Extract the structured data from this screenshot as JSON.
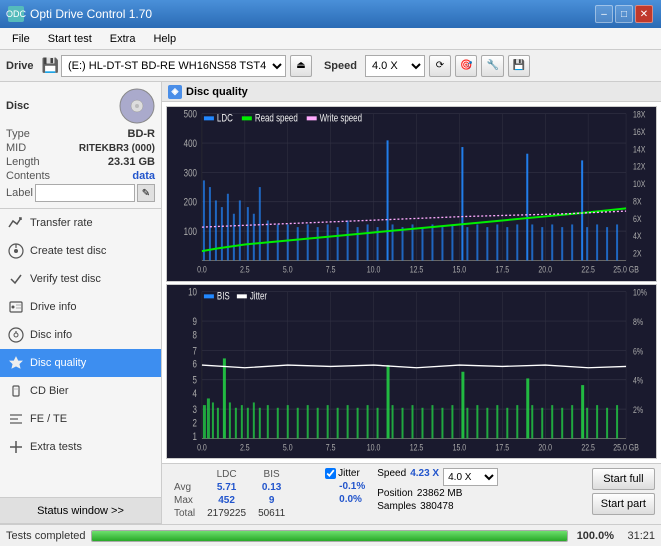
{
  "app": {
    "title": "Opti Drive Control 1.70",
    "icon": "ODC"
  },
  "titlebar": {
    "minimize": "–",
    "maximize": "□",
    "close": "✕"
  },
  "menu": {
    "items": [
      "File",
      "Start test",
      "Extra",
      "Help"
    ]
  },
  "toolbar": {
    "drive_label": "Drive",
    "drive_value": "(E:)  HL-DT-ST BD-RE  WH16NS58 TST4",
    "speed_label": "Speed",
    "speed_value": "4.0 X"
  },
  "disc": {
    "section_title": "Disc",
    "type_label": "Type",
    "type_value": "BD-R",
    "mid_label": "MID",
    "mid_value": "RITEKBR3 (000)",
    "length_label": "Length",
    "length_value": "23.31 GB",
    "contents_label": "Contents",
    "contents_value": "data",
    "label_label": "Label"
  },
  "nav": {
    "items": [
      {
        "id": "transfer-rate",
        "label": "Transfer rate",
        "icon": "📈"
      },
      {
        "id": "create-test-disc",
        "label": "Create test disc",
        "icon": "💿"
      },
      {
        "id": "verify-test-disc",
        "label": "Verify test disc",
        "icon": "✓"
      },
      {
        "id": "drive-info",
        "label": "Drive info",
        "icon": "ℹ"
      },
      {
        "id": "disc-info",
        "label": "Disc info",
        "icon": "📀"
      },
      {
        "id": "disc-quality",
        "label": "Disc quality",
        "icon": "★",
        "active": true
      },
      {
        "id": "cd-bier",
        "label": "CD Bier",
        "icon": "🍺"
      },
      {
        "id": "fe-te",
        "label": "FE / TE",
        "icon": "≋"
      },
      {
        "id": "extra-tests",
        "label": "Extra tests",
        "icon": "+"
      }
    ]
  },
  "disc_quality": {
    "title": "Disc quality"
  },
  "chart1": {
    "legend": [
      {
        "label": "LDC",
        "color": "#0099ff"
      },
      {
        "label": "Read speed",
        "color": "#00ee00"
      },
      {
        "label": "Write speed",
        "color": "#ff66ff"
      }
    ],
    "y_max": 500,
    "y_right_labels": [
      "18X",
      "16X",
      "14X",
      "12X",
      "10X",
      "8X",
      "6X",
      "4X",
      "2X"
    ],
    "x_labels": [
      "0.0",
      "2.5",
      "5.0",
      "7.5",
      "10.0",
      "12.5",
      "15.0",
      "17.5",
      "20.0",
      "22.5",
      "25.0 GB"
    ]
  },
  "chart2": {
    "legend": [
      {
        "label": "BIS",
        "color": "#0099ff"
      },
      {
        "label": "Jitter",
        "color": "#ffffff"
      }
    ],
    "y_max": 10,
    "y_right_labels": [
      "10%",
      "8%",
      "6%",
      "4%",
      "2%"
    ],
    "x_labels": [
      "0.0",
      "2.5",
      "5.0",
      "7.5",
      "10.0",
      "12.5",
      "15.0",
      "17.5",
      "20.0",
      "22.5",
      "25.0 GB"
    ]
  },
  "stats": {
    "headers": [
      "LDC",
      "BIS",
      "",
      "Jitter",
      "Speed"
    ],
    "avg_label": "Avg",
    "avg_ldc": "5.71",
    "avg_bis": "0.13",
    "avg_jitter": "-0.1%",
    "max_label": "Max",
    "max_ldc": "452",
    "max_bis": "9",
    "max_jitter": "0.0%",
    "total_label": "Total",
    "total_ldc": "2179225",
    "total_bis": "50611",
    "jitter_checked": true,
    "jitter_label": "Jitter",
    "speed_current_label": "Speed",
    "speed_current_value": "4.23 X",
    "position_label": "Position",
    "position_value": "23862 MB",
    "samples_label": "Samples",
    "samples_value": "380478",
    "speed_select_value": "4.0 X"
  },
  "buttons": {
    "start_full": "Start full",
    "start_part": "Start part"
  },
  "statusbar": {
    "text": "Tests completed",
    "progress": 100,
    "percent": "100.0%",
    "time": "31:21"
  }
}
